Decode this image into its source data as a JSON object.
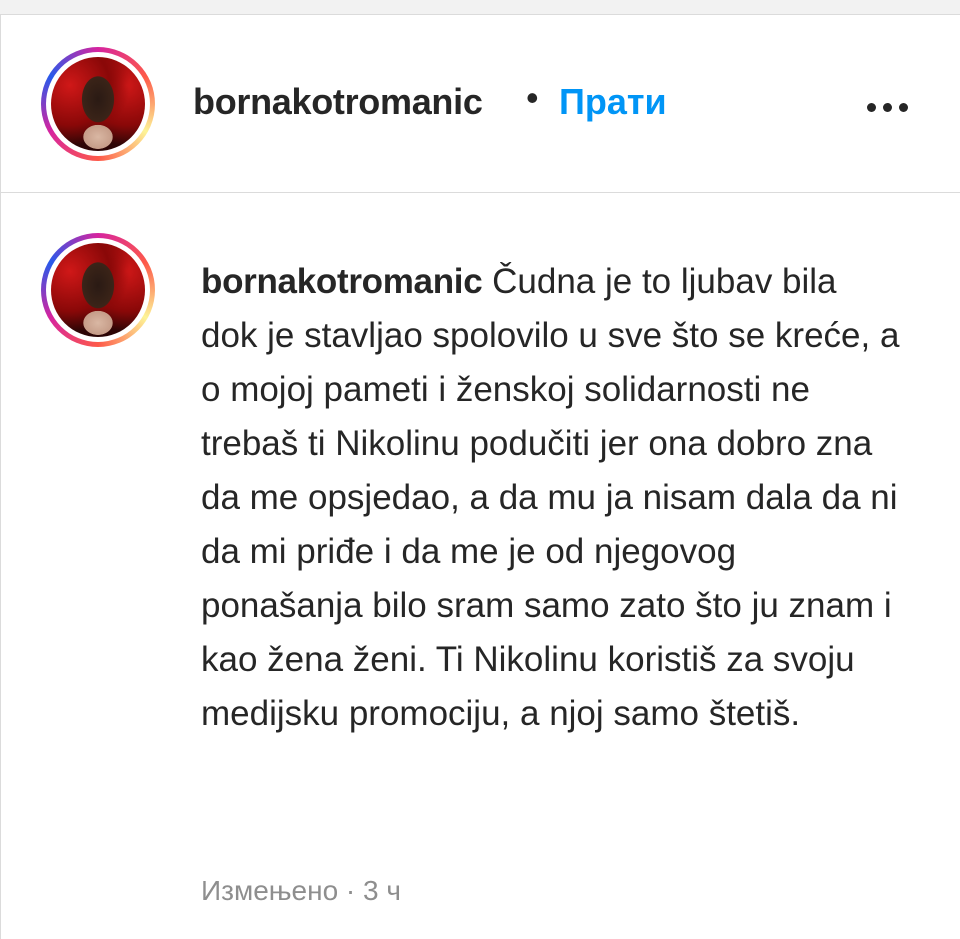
{
  "header": {
    "username": "bornakotromanic",
    "separator": "•",
    "follow_label": "Прати",
    "more_icon": "more-horizontal-icon"
  },
  "comment": {
    "username": "bornakotromanic",
    "text": "Čudna je to ljubav bila dok je stavljao spolovilo u sve što se kreće, a o mojoj pameti i ženskoj solidarnosti ne trebaš ti Nikolinu podučiti jer ona dobro zna da me opsjedao, a da mu ja nisam dala da ni da mi priđe i da me je od njegovog ponašanja bilo sram samo zato što ju znam i kao žena ženi. Ti Nikolinu koristiš za svoju medijsku promociju, a njoj samo štetiš.",
    "meta": "Измењено · 3 ч"
  },
  "colors": {
    "link": "#0095f6",
    "text": "#262626",
    "muted": "#8e8e8e",
    "border": "#dbdbdb"
  }
}
